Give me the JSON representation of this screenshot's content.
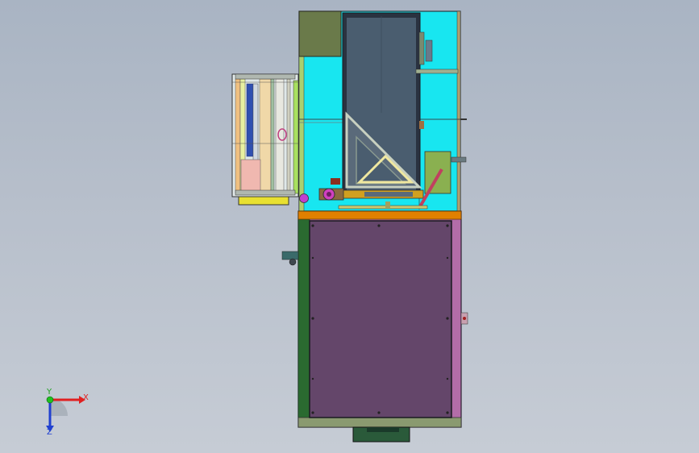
{
  "viewport": {
    "background_top": "#a9b4c3",
    "background_bottom": "#c6ccd5"
  },
  "model": {
    "upper_frame_color": "#18e6f0",
    "hopper_color": "#4a5d6f",
    "base_panel_color": "#64466a",
    "base_edge_color": "#b36da8",
    "rail_color": "#e08000",
    "roll_color": "#f0c080",
    "feed_color": "#e8e030"
  },
  "triad": {
    "x_label": "X",
    "y_label": "Y",
    "z_label": "Z",
    "x_color": "#e02020",
    "y_color": "#20c020",
    "z_color": "#2040d0"
  }
}
